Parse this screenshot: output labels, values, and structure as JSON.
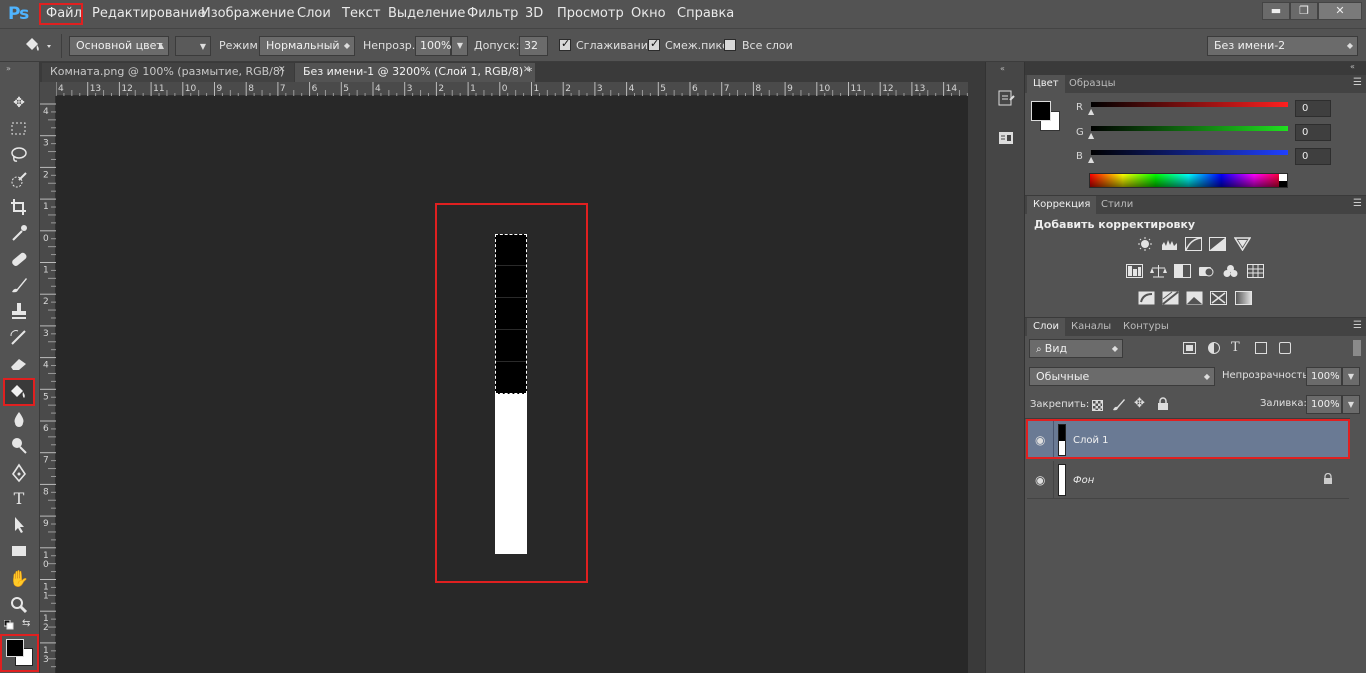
{
  "app": {
    "logo": "Ps"
  },
  "menu": [
    "Файл",
    "Редактирование",
    "Изображение",
    "Слои",
    "Текст",
    "Выделение",
    "Фильтр",
    "3D",
    "Просмотр",
    "Окно",
    "Справка"
  ],
  "window_controls": {
    "minimize": "▬",
    "restore": "❐",
    "close": "✕"
  },
  "options": {
    "fill_source": "Основной цвет",
    "mode_label": "Режим:",
    "mode_value": "Нормальный",
    "opacity_label": "Непрозр.:",
    "opacity_value": "100%",
    "tolerance_label": "Допуск:",
    "tolerance_value": "32",
    "antialias_label": "Сглаживание",
    "antialias_checked": true,
    "contiguous_label": "Смеж.пикс",
    "contiguous_checked": true,
    "all_layers_label": "Все слои",
    "all_layers_checked": false,
    "workspace": "Без имени-2"
  },
  "tabs": [
    {
      "label": "Комната.png @ 100% (размытие, RGB/8)",
      "close": "✕",
      "active": false
    },
    {
      "label": "Без имени-1 @ 3200% (Слой 1, RGB/8) *",
      "close": "✕",
      "active": true
    }
  ],
  "ruler_top": [
    "4",
    "13",
    "12",
    "11",
    "10",
    "9",
    "8",
    "7",
    "6",
    "5",
    "4",
    "3",
    "2",
    "1",
    "0",
    "1",
    "2",
    "3",
    "4",
    "5",
    "6",
    "7",
    "8",
    "9",
    "10",
    "11",
    "12",
    "13",
    "14"
  ],
  "ruler_left": [
    "4",
    "3",
    "2",
    "1",
    "0",
    "1",
    "2",
    "3",
    "4",
    "5",
    "6",
    "7",
    "8",
    "9",
    "1 0",
    "1 1",
    "1 2",
    "1 3"
  ],
  "color_panel": {
    "tabs": [
      "Цвет",
      "Образцы"
    ],
    "channels": [
      {
        "name": "R",
        "value": "0",
        "color": "#ff2020"
      },
      {
        "name": "G",
        "value": "0",
        "color": "#20e020"
      },
      {
        "name": "B",
        "value": "0",
        "color": "#2040ff"
      }
    ],
    "foreground": "#000000",
    "background": "#ffffff"
  },
  "adjust_panel": {
    "tabs": [
      "Коррекция",
      "Стили"
    ],
    "heading": "Добавить корректировку"
  },
  "layers_panel": {
    "tabs": [
      "Слои",
      "Каналы",
      "Контуры"
    ],
    "filter": "Вид",
    "blend_mode": "Обычные",
    "opacity_label": "Непрозрачность:",
    "opacity_value": "100%",
    "lock_label": "Закрепить:",
    "fill_label": "Заливка:",
    "fill_value": "100%",
    "layers": [
      {
        "name": "Слой 1",
        "selected": true,
        "locked": false
      },
      {
        "name": "Фон",
        "selected": false,
        "locked": true
      }
    ]
  },
  "colors": {
    "highlight": "#e02020",
    "selected_layer": "#6a7a94"
  }
}
